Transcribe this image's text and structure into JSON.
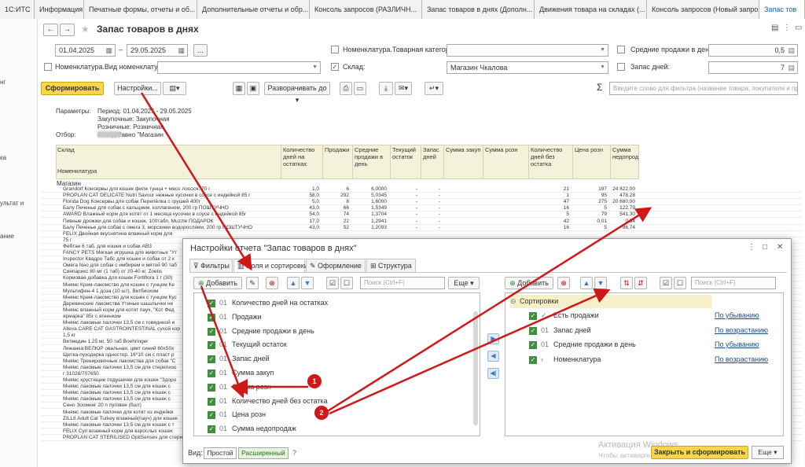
{
  "tabs": [
    {
      "label": "1С:ИТС",
      "width": 44
    },
    {
      "label": "Информация",
      "width": 63
    },
    {
      "label": "Печатные формы, отчеты и об...",
      "width": 144
    },
    {
      "label": "Дополнительные отчеты и обр...",
      "width": 143
    },
    {
      "label": "Консоль запросов (РАЗЛИЧН...",
      "width": 143
    },
    {
      "label": "Запас товаров в днях (Дополн...",
      "width": 143
    },
    {
      "label": "Движения товара на складах (...",
      "width": 143
    },
    {
      "label": "Консоль запросов (Новый запро...",
      "width": 143
    },
    {
      "label": "Запас тов",
      "width": 58
    }
  ],
  "left_panel": [
    "нг",
    "ка",
    "ультат и",
    "ание"
  ],
  "header": {
    "title": "Запас товаров в днях"
  },
  "filters": {
    "date_from": "01.04.2025",
    "date_sep": "–",
    "date_to": "29.05.2025",
    "more": "...",
    "nom_view_label": "Номенклатура.Вид номенклатуры:",
    "category_label": "Номенклатура.Товарная категория:",
    "sklad_label": "Склад:",
    "sklad_value": "Магазин Чкалова",
    "avg_sales_label": "Средние продажи в день:",
    "avg_sales_value": "0,5",
    "stock_days_label": "Запас дней:",
    "stock_days_value": "7"
  },
  "toolbar": {
    "generate": "Сформировать",
    "settings": "Настройки...",
    "expand": "Разворачивать до",
    "search_placeholder": "Введите слово для фильтра (название товара, покупателя и пр.)"
  },
  "report": {
    "params_label": "Параметры:",
    "period": "Период: 01.04.2025 - 29.05.2025",
    "purchase": "Закупочные: Закупочная",
    "retail": "Розничные: Розничная",
    "filter_label": "Отбор:",
    "filter_value": "Склад Равно \"Магазин",
    "col_sklad": "Склад",
    "col_nom": "Номенклатура",
    "columns": [
      "Количество дней на остатках",
      "Продажи",
      "Средние продажи в день",
      "Текущий остаток",
      "Запас дней",
      "Сумма закуп",
      "Сумма розн",
      "Количество дней без остатка",
      "Цена розн",
      "Сумма недопродаж"
    ],
    "group": "Магазин",
    "rows": [
      {
        "name": "Grandorf Консервы для кошек филе тунца + мясо лосося, 70 г",
        "v1": "1,0",
        "v2": "6",
        "v3": "6,0000",
        "v4": "-",
        "v5": "-",
        "v6": "21",
        "v7": "197",
        "v8": "24 822,00"
      },
      {
        "name": "PROPLAN CAT DELICATE Nutri Savour нежные кусочки в соусе с индейкой 85 г",
        "v1": "58,0",
        "v2": "292",
        "v3": "5,0345",
        "v4": "-",
        "v5": "-",
        "v6": "1",
        "v7": "95",
        "v8": "478,28"
      },
      {
        "name": "Florida Dog Консервы для собак Перепёлка с грушей 400г",
        "v1": "5,0",
        "v2": "8",
        "v3": "1,6000",
        "v4": "-",
        "v5": "-",
        "v6": "47",
        "v7": "275",
        "v8": "20 680,00"
      },
      {
        "name": "Балу Печенье для собак с кальцием, коллагеном, 200 гр ПОШТУЧНО",
        "v1": "43,0",
        "v2": "66",
        "v3": "1,5349",
        "v4": "-",
        "v5": "-",
        "v6": "16",
        "v7": "5",
        "v8": "122,79"
      },
      {
        "name": "AWARD Влажный корм для котят от 1 месяца кусочки в соусе с индейкой 85г",
        "v1": "54,0",
        "v2": "74",
        "v3": "1,3704",
        "v4": "-",
        "v5": "-",
        "v6": "5",
        "v7": "79",
        "v8": "541,30"
      },
      {
        "name": "Пивные дрожжи для собак и кошек, 100табл, Muzzle ПОДАРОК",
        "v1": "17,0",
        "v2": "22",
        "v3": "1,2941",
        "v4": "-",
        "v5": "-",
        "v6": "42",
        "v7": "0,01",
        "v8": "0,54"
      },
      {
        "name": "Балу Печенье для собак с омега 3, морскими водорослями, 200 гр ПОШТУЧНО",
        "v1": "43,0",
        "v2": "52",
        "v3": "1,2093",
        "v4": "-",
        "v5": "-",
        "v6": "16",
        "v7": "5",
        "v8": "96,74"
      },
      {
        "name": "FELIX Двойная вкуснятина влажный корм для",
        "v1": "",
        "v2": "",
        "v3": "",
        "v4": "",
        "v5": "",
        "v6": "",
        "v7": "",
        "v8": ""
      },
      {
        "name": "75 г",
        "v1": "",
        "v2": "",
        "v3": "",
        "v4": "",
        "v5": "",
        "v6": "",
        "v7": "",
        "v8": ""
      },
      {
        "name": "Фебтан 6 таб. для кошек и собак АВЗ",
        "v1": "",
        "v2": "",
        "v3": "",
        "v4": "",
        "v5": "",
        "v6": "",
        "v7": "",
        "v8": ""
      },
      {
        "name": "FANCY PETS Мягкая игрушка для животных \"Ут",
        "v1": "",
        "v2": "",
        "v3": "",
        "v4": "",
        "v5": "",
        "v6": "",
        "v7": "",
        "v8": ""
      },
      {
        "name": "Inspector Квадро Табс для кошек и собак от 2 к",
        "v1": "",
        "v2": "",
        "v3": "",
        "v4": "",
        "v5": "",
        "v6": "",
        "v7": "",
        "v8": ""
      },
      {
        "name": "Омега Neo для собак с имбирем и мятой 90 таб",
        "v1": "",
        "v2": "",
        "v3": "",
        "v4": "",
        "v5": "",
        "v6": "",
        "v7": "",
        "v8": ""
      },
      {
        "name": "Синпарикс 80 мг (1 таб) от 20-40 кг, Zoetis",
        "v1": "",
        "v2": "",
        "v3": "",
        "v4": "",
        "v5": "",
        "v6": "",
        "v7": "",
        "v8": ""
      },
      {
        "name": "Кормовая добавка для кошек Fortiflora 1 г (30)",
        "v1": "",
        "v2": "",
        "v3": "",
        "v4": "",
        "v5": "",
        "v6": "",
        "v7": "",
        "v8": ""
      },
      {
        "name": "Мнямс Крем-лакомство для кошек с тунцом Ке",
        "v1": "",
        "v2": "",
        "v3": "",
        "v4": "",
        "v5": "",
        "v6": "",
        "v7": "",
        "v8": ""
      },
      {
        "name": "Мультифен-4 1 доза (10 шт), Ветбиохим",
        "v1": "",
        "v2": "",
        "v3": "",
        "v4": "",
        "v5": "",
        "v6": "",
        "v7": "",
        "v8": ""
      },
      {
        "name": "Мнямс Крем-лакомство для кошек с тунцом Кус",
        "v1": "",
        "v2": "",
        "v3": "",
        "v4": "",
        "v5": "",
        "v6": "",
        "v7": "",
        "v8": ""
      },
      {
        "name": "Деревенские лакомства Утиные шашлычки не",
        "v1": "",
        "v2": "",
        "v3": "",
        "v4": "",
        "v5": "",
        "v6": "",
        "v7": "",
        "v8": ""
      },
      {
        "name": "Мнямс влажный корм для котят пауч, \"Кот Фед",
        "v1": "",
        "v2": "",
        "v3": "",
        "v4": "",
        "v5": "",
        "v6": "",
        "v7": "",
        "v8": ""
      },
      {
        "name": "ярмарка\" 85г с ягненком",
        "v1": "",
        "v2": "",
        "v3": "",
        "v4": "",
        "v5": "",
        "v6": "",
        "v7": "",
        "v8": ""
      },
      {
        "name": "Мнямс лакомые палочки 13,5 см с говядиной и",
        "v1": "",
        "v2": "",
        "v3": "",
        "v4": "",
        "v5": "",
        "v6": "",
        "v7": "",
        "v8": ""
      },
      {
        "name": "Alleva CARE CAT GASTROINTESTINAL сухой кор",
        "v1": "",
        "v2": "",
        "v3": "",
        "v4": "",
        "v5": "",
        "v6": "",
        "v7": "",
        "v8": ""
      },
      {
        "name": "1,5 кг",
        "v1": "",
        "v2": "",
        "v3": "",
        "v4": "",
        "v5": "",
        "v6": "",
        "v7": "",
        "v8": ""
      },
      {
        "name": "Ветмедин 1,25 мг, 50 таб Boehringer",
        "v1": "",
        "v2": "",
        "v3": "",
        "v4": "",
        "v5": "",
        "v6": "",
        "v7": "",
        "v8": ""
      },
      {
        "name": "Лежанка ВЕЛЮР овальная, цвет синий 60х50х",
        "v1": "",
        "v2": "",
        "v3": "",
        "v4": "",
        "v5": "",
        "v6": "",
        "v7": "",
        "v8": ""
      },
      {
        "name": "Щетка-пуходерка одностор. 16*10 см с пласт р",
        "v1": "",
        "v2": "",
        "v3": "",
        "v4": "",
        "v5": "",
        "v6": "",
        "v7": "",
        "v8": ""
      },
      {
        "name": "Мнямс Тренировочные лакомства для собак \"С",
        "v1": "",
        "v2": "",
        "v3": "",
        "v4": "",
        "v5": "",
        "v6": "",
        "v7": "",
        "v8": ""
      },
      {
        "name": "Мнямс лакомые палочки 13,5 см для стерилизо",
        "v1": "",
        "v2": "",
        "v3": "",
        "v4": "",
        "v5": "",
        "v6": "",
        "v7": "",
        "v8": ""
      },
      {
        "name": "г 31028/707650",
        "v1": "",
        "v2": "",
        "v3": "",
        "v4": "",
        "v5": "",
        "v6": "",
        "v7": "",
        "v8": ""
      },
      {
        "name": "Мнямс хрустящие подушечки для кошек \"Здоро",
        "v1": "",
        "v2": "",
        "v3": "",
        "v4": "",
        "v5": "",
        "v6": "",
        "v7": "",
        "v8": ""
      },
      {
        "name": "Мнямс лакомые палочки 13,5 см для кошек с",
        "v1": "",
        "v2": "",
        "v3": "",
        "v4": "",
        "v5": "",
        "v6": "",
        "v7": "",
        "v8": ""
      },
      {
        "name": "Мнямс лакомые палочки 13,5 см для кошек с",
        "v1": "",
        "v2": "",
        "v3": "",
        "v4": "",
        "v5": "",
        "v6": "",
        "v7": "",
        "v8": ""
      },
      {
        "name": "Мнямс лакомые палочки 13,5 см для кошек с",
        "v1": "",
        "v2": "",
        "v3": "",
        "v4": "",
        "v5": "",
        "v6": "",
        "v7": "",
        "v8": ""
      },
      {
        "name": "Сено Зооминг 20 п пуговое (бшт)",
        "v1": "",
        "v2": "",
        "v3": "",
        "v4": "",
        "v5": "",
        "v6": "",
        "v7": "",
        "v8": ""
      },
      {
        "name": "Мнямс лакомые палочки для котят из индейки",
        "v1": "",
        "v2": "",
        "v3": "",
        "v4": "",
        "v5": "",
        "v6": "",
        "v7": "",
        "v8": ""
      },
      {
        "name": "ZILLII Adult Cat Turkey влажный(пауч) для кошек",
        "v1": "",
        "v2": "",
        "v3": "",
        "v4": "",
        "v5": "",
        "v6": "",
        "v7": "",
        "v8": ""
      },
      {
        "name": "Мнямс лакомые палочки 13,5 см для кошек с т",
        "v1": "",
        "v2": "",
        "v3": "",
        "v4": "",
        "v5": "",
        "v6": "",
        "v7": "",
        "v8": ""
      },
      {
        "name": "FELIX Суп влажный корм для взрослых кошек",
        "v1": "",
        "v2": "",
        "v3": "",
        "v4": "",
        "v5": "",
        "v6": "",
        "v7": "",
        "v8": ""
      },
      {
        "name": "PROPLAN CAT STERILISED OptiSenses для стерильных кошек кусочки с курицей",
        "v1": "",
        "v2": "",
        "v3": "",
        "v4": "",
        "v5": "",
        "v6": "",
        "v7": "",
        "v8": ""
      }
    ]
  },
  "dialog": {
    "title": "Настройки отчета \"Запас товаров в днях\"",
    "tabs": [
      "Фильтры",
      "Поля и сортировки",
      "Оформление",
      "Структура"
    ],
    "add": "Добавить",
    "search_placeholder": "Поиск (Ctrl+F)",
    "more": "Еще",
    "fields": [
      {
        "lvl": "01",
        "text": "Количество дней на остатках"
      },
      {
        "lvl": "01",
        "text": "Продажи"
      },
      {
        "lvl": "01",
        "text": "Средние продажи в день"
      },
      {
        "lvl": "01",
        "text": "Текущий остаток"
      },
      {
        "lvl": "01",
        "text": "Запас дней"
      },
      {
        "lvl": "01",
        "text": "Сумма закуп"
      },
      {
        "lvl": "01",
        "text": "Сумма розн"
      },
      {
        "lvl": "01",
        "text": "Количество дней без остатка"
      },
      {
        "lvl": "01",
        "text": "Цена розн"
      },
      {
        "lvl": "01",
        "text": "Сумма недопродаж"
      }
    ],
    "sort_header": "Сортировки",
    "sorts": [
      {
        "lvl": "✓",
        "text": "Есть продажи",
        "order": "По убыванию"
      },
      {
        "lvl": "01",
        "text": "Запас дней",
        "order": "По возрастанию"
      },
      {
        "lvl": "01",
        "text": "Средние продажи в день",
        "order": "По убыванию"
      },
      {
        "lvl": "›",
        "text": "Номенклатура",
        "order": "По возрастанию"
      }
    ],
    "view_label": "Вид:",
    "view_simple": "Простой",
    "view_advanced": "Расширенный",
    "help": "?",
    "close_and_generate": "Закрыть и сформировать",
    "more_bottom": "Еще"
  },
  "annotations": {
    "badge1": "1",
    "badge2": "2"
  },
  "watermark": {
    "line1": "Активация Windows",
    "line2": "Чтобы активировать Windows, перейдите в раздел \"Параметры\"."
  },
  "colors": {
    "accent": "#f9d649",
    "arrow": "#d01818",
    "header_bg": "#f5f2dc",
    "link": "#1a4e8a"
  }
}
